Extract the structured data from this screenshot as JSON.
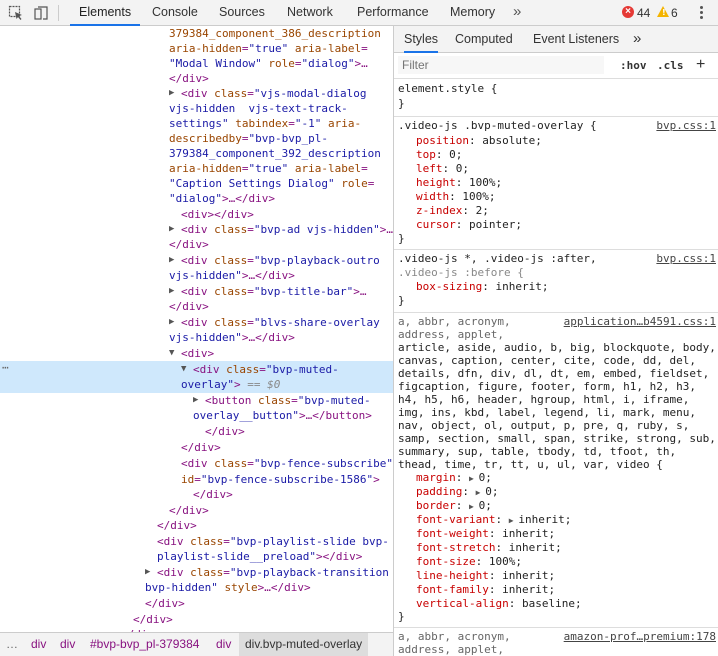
{
  "toolbar": {
    "tabs": [
      "Elements",
      "Console",
      "Sources",
      "Network",
      "Performance",
      "Memory"
    ],
    "more_tabs": "»",
    "error_count": "44",
    "warning_count": "6"
  },
  "elements_tree": [
    {
      "parts": [
        [
          "an",
          "379384_component_386_description"
        ]
      ]
    },
    {
      "parts": [
        [
          "an",
          "aria-hidden"
        ],
        [
          "tn",
          "="
        ],
        [
          "av",
          "\"true\""
        ],
        [
          "an",
          " aria-label"
        ],
        [
          "tn",
          "="
        ]
      ]
    },
    {
      "parts": [
        [
          "av",
          "\"Modal Window\""
        ],
        [
          "an",
          " role"
        ],
        [
          "tn",
          "="
        ],
        [
          "av",
          "\"dialog\""
        ],
        [
          "tn",
          ">…"
        ]
      ]
    },
    {
      "parts": [
        [
          "tn",
          "</div>"
        ]
      ]
    },
    {
      "parts": [
        [
          "tn",
          "<div "
        ],
        [
          "an",
          "class"
        ],
        [
          "tn",
          "="
        ],
        [
          "av",
          "\"vjs-modal-dialog"
        ]
      ]
    },
    {
      "parts": [
        [
          "av",
          "vjs-hidden  vjs-text-track-"
        ]
      ]
    },
    {
      "parts": [
        [
          "av",
          "settings\""
        ],
        [
          "an",
          " tabindex"
        ],
        [
          "tn",
          "="
        ],
        [
          "av",
          "\"-1\""
        ],
        [
          "an",
          " aria-"
        ]
      ]
    },
    {
      "parts": [
        [
          "an",
          "describedby"
        ],
        [
          "tn",
          "="
        ],
        [
          "av",
          "\"bvp-bvp_pl-"
        ]
      ]
    },
    {
      "parts": [
        [
          "av",
          "379384_component_392_description"
        ]
      ]
    },
    {
      "parts": [
        [
          "an",
          "aria-hidden"
        ],
        [
          "tn",
          "="
        ],
        [
          "av",
          "\"true\""
        ],
        [
          "an",
          " aria-label"
        ],
        [
          "tn",
          "="
        ]
      ]
    },
    {
      "parts": [
        [
          "av",
          "\"Caption Settings Dialog\""
        ],
        [
          "an",
          " role"
        ],
        [
          "tn",
          "="
        ]
      ]
    },
    {
      "parts": [
        [
          "av",
          "\"dialog\""
        ],
        [
          "tn",
          ">…</div>"
        ]
      ]
    },
    {
      "parts": [
        [
          "tn",
          "<div></div>"
        ]
      ]
    },
    {
      "parts": [
        [
          "tn",
          "<div "
        ],
        [
          "an",
          "class"
        ],
        [
          "tn",
          "="
        ],
        [
          "av",
          "\"bvp-ad vjs-hidden\""
        ],
        [
          "tn",
          ">…"
        ]
      ]
    },
    {
      "parts": [
        [
          "tn",
          "</div>"
        ]
      ]
    },
    {
      "parts": [
        [
          "tn",
          "<div "
        ],
        [
          "an",
          "class"
        ],
        [
          "tn",
          "="
        ],
        [
          "av",
          "\"bvp-playback-outro"
        ]
      ]
    },
    {
      "parts": [
        [
          "av",
          "vjs-hidden\""
        ],
        [
          "tn",
          ">…</div>"
        ]
      ]
    },
    {
      "parts": [
        [
          "tn",
          "<div "
        ],
        [
          "an",
          "class"
        ],
        [
          "tn",
          "="
        ],
        [
          "av",
          "\"bvp-title-bar\""
        ],
        [
          "tn",
          ">…"
        ]
      ]
    },
    {
      "parts": [
        [
          "tn",
          "</div>"
        ]
      ]
    },
    {
      "parts": [
        [
          "tn",
          "<div "
        ],
        [
          "an",
          "class"
        ],
        [
          "tn",
          "="
        ],
        [
          "av",
          "\"blvs-share-overlay"
        ]
      ]
    },
    {
      "parts": [
        [
          "av",
          "vjs-hidden\""
        ],
        [
          "tn",
          ">…</div>"
        ]
      ]
    },
    {
      "parts": [
        [
          "tn",
          "<div>"
        ]
      ]
    },
    {
      "parts": [
        [
          "tn",
          "<div "
        ],
        [
          "an",
          "class"
        ],
        [
          "tn",
          "="
        ],
        [
          "av",
          "\"bvp-muted-"
        ]
      ]
    },
    {
      "parts": [
        [
          "av",
          "overlay\""
        ],
        [
          "tn",
          "> "
        ],
        [
          "eq",
          "== $0"
        ]
      ]
    },
    {
      "parts": [
        [
          "tn",
          "<button "
        ],
        [
          "an",
          "class"
        ],
        [
          "tn",
          "="
        ],
        [
          "av",
          "\"bvp-muted-"
        ]
      ]
    },
    {
      "parts": [
        [
          "av",
          "overlay__button\""
        ],
        [
          "tn",
          ">…</button>"
        ]
      ]
    },
    {
      "parts": [
        [
          "tn",
          "</div>"
        ]
      ]
    },
    {
      "parts": [
        [
          "tn",
          "</div>"
        ]
      ]
    },
    {
      "parts": [
        [
          "tn",
          "<div "
        ],
        [
          "an",
          "class"
        ],
        [
          "tn",
          "="
        ],
        [
          "av",
          "\"bvp-fence-subscribe\""
        ]
      ]
    },
    {
      "parts": [
        [
          "an",
          "id"
        ],
        [
          "tn",
          "="
        ],
        [
          "av",
          "\"bvp-fence-subscribe-1586\""
        ],
        [
          "tn",
          ">"
        ]
      ]
    },
    {
      "parts": [
        [
          "tn",
          "</div>"
        ]
      ]
    },
    {
      "parts": [
        [
          "tn",
          "</div>"
        ]
      ]
    },
    {
      "parts": [
        [
          "tn",
          "</div>"
        ]
      ]
    },
    {
      "parts": [
        [
          "tn",
          "<div "
        ],
        [
          "an",
          "class"
        ],
        [
          "tn",
          "="
        ],
        [
          "av",
          "\"bvp-playlist-slide bvp-"
        ]
      ]
    },
    {
      "parts": [
        [
          "av",
          "playlist-slide__preload\""
        ],
        [
          "tn",
          "></div>"
        ]
      ]
    },
    {
      "parts": [
        [
          "tn",
          "<div "
        ],
        [
          "an",
          "class"
        ],
        [
          "tn",
          "="
        ],
        [
          "av",
          "\"bvp-playback-transition"
        ]
      ]
    },
    {
      "parts": [
        [
          "av",
          "bvp-hidden\""
        ],
        [
          "an",
          " style"
        ],
        [
          "tn",
          ">…</div>"
        ]
      ]
    },
    {
      "parts": [
        [
          "tn",
          "</div>"
        ]
      ]
    },
    {
      "parts": [
        [
          "tn",
          "</div>"
        ]
      ]
    },
    {
      "parts": [
        [
          "tn",
          "</div>"
        ]
      ]
    }
  ],
  "breadcrumbs": [
    "…",
    "div",
    "div",
    "#bvp-bvp_pl-379384",
    "div",
    "div.bvp-muted-overlay"
  ],
  "side_tabs": [
    "Styles",
    "Computed",
    "Event Listeners",
    "»"
  ],
  "filter": {
    "placeholder": "Filter",
    "hov": ":hov",
    "cls": ".cls",
    "plus": "+"
  },
  "styles_rules": {
    "element_style": {
      "selector": "element.style {",
      "close": "}"
    },
    "muted_overlay": {
      "selector": ".video-js .bvp-muted-overlay {",
      "source": "bvp.css:1",
      "props": [
        {
          "name": "position",
          "value": "absolute;"
        },
        {
          "name": "top",
          "value": "0;"
        },
        {
          "name": "left",
          "value": "0;"
        },
        {
          "name": "height",
          "value": "100%;"
        },
        {
          "name": "width",
          "value": "100%;"
        },
        {
          "name": "z-index",
          "value": "2;"
        },
        {
          "name": "cursor",
          "value": "pointer;"
        }
      ]
    },
    "box_sizing": {
      "selector_line1": ".video-js *, .video-js :after,",
      "selector_line2": ".video-js :before {",
      "source": "bvp.css:1",
      "prop": "box-sizing",
      "value": "inherit;"
    },
    "reset": {
      "source": "application…b4591.css:1",
      "selector_lines": [
        "a, abbr, acronym,",
        "address, applet,",
        "article, aside, audio, b, big, blockquote, body,",
        "canvas, caption, center, cite, code, dd, del,",
        "details, dfn, div, dl, dt, em, embed, fieldset,",
        "figcaption, figure, footer, form, h1, h2, h3,",
        "h4, h5, h6, header, hgroup, html, i, iframe,",
        "img, ins, kbd, label, legend, li, mark, menu,",
        "nav, object, ol, output, p, pre, q, ruby, s,",
        "samp, section, small, span, strike, strong, sub,",
        "summary, sup, table, tbody, td, tfoot, th,",
        "thead, time, tr, tt, u, ul, var, video {"
      ],
      "props": [
        {
          "name": "margin",
          "value": "0;",
          "expand": true
        },
        {
          "name": "padding",
          "value": "0;",
          "expand": true
        },
        {
          "name": "border",
          "value": "0;",
          "expand": true
        },
        {
          "name": "font-variant",
          "value": "inherit;",
          "expand": true
        },
        {
          "name": "font-weight",
          "value": "inherit;"
        },
        {
          "name": "font-stretch",
          "value": "inherit;"
        },
        {
          "name": "font-size",
          "value": "100%;"
        },
        {
          "name": "line-height",
          "value": "inherit;"
        },
        {
          "name": "font-family",
          "value": "inherit;"
        },
        {
          "name": "vertical-align",
          "value": "baseline;"
        }
      ]
    },
    "amazon": {
      "source": "amazon-prof…premium:178",
      "selector_lines": [
        "a, abbr, acronym,",
        "address, applet,"
      ]
    }
  }
}
